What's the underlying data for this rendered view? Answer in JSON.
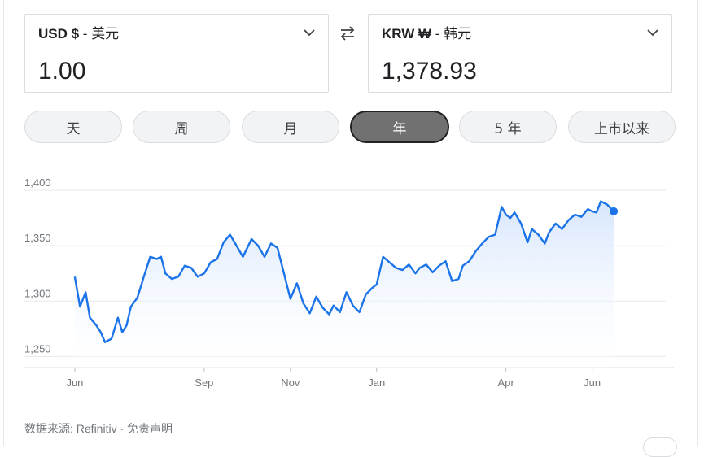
{
  "from_currency": {
    "code": "USD $",
    "name": "美元",
    "separator": " - ",
    "value": "1.00"
  },
  "to_currency": {
    "code": "KRW ₩",
    "name": "韩元",
    "separator": " - ",
    "value": "1,378.93"
  },
  "swap_icon": "swap-arrows-icon",
  "range_tabs": [
    {
      "label": "天",
      "active": false
    },
    {
      "label": "周",
      "active": false
    },
    {
      "label": "月",
      "active": false
    },
    {
      "label": "年",
      "active": true
    },
    {
      "label": "5 年",
      "active": false
    },
    {
      "label": "上市以来",
      "active": false
    }
  ],
  "footer": {
    "text": "数据来源: Refinitiv · 免责声明"
  },
  "colors": {
    "line": "#1a73e8",
    "fill_top": "#d2e3fc",
    "active_tab": "#717171",
    "grid": "#e8eaed"
  },
  "chart_data": {
    "type": "area",
    "ylim": [
      1240,
      1400
    ],
    "yticks": [
      1250,
      1300,
      1350,
      1400
    ],
    "ytick_labels": [
      "1,250",
      "1,300",
      "1,350",
      "1,400"
    ],
    "xtick_labels": [
      "Jun",
      "Sep",
      "Nov",
      "Jan",
      "Apr",
      "Jun"
    ],
    "xtick_positions": [
      0,
      3,
      5,
      7,
      10,
      12
    ],
    "xlim": [
      -0.15,
      12.8
    ],
    "grid": true,
    "x": [
      0,
      0.12,
      0.25,
      0.35,
      0.5,
      0.6,
      0.7,
      0.85,
      1.0,
      1.1,
      1.2,
      1.3,
      1.45,
      1.6,
      1.75,
      1.9,
      2.0,
      2.1,
      2.25,
      2.4,
      2.55,
      2.7,
      2.85,
      3.0,
      3.15,
      3.3,
      3.45,
      3.6,
      3.75,
      3.9,
      4.0,
      4.1,
      4.25,
      4.4,
      4.55,
      4.7,
      4.85,
      5.0,
      5.15,
      5.3,
      5.45,
      5.6,
      5.75,
      5.9,
      6.0,
      6.15,
      6.3,
      6.45,
      6.6,
      6.75,
      6.9,
      7.0,
      7.15,
      7.3,
      7.45,
      7.6,
      7.75,
      7.9,
      8.0,
      8.15,
      8.3,
      8.45,
      8.6,
      8.75,
      8.9,
      9.0,
      9.15,
      9.3,
      9.45,
      9.6,
      9.75,
      9.9,
      10.0,
      10.1,
      10.2,
      10.35,
      10.5,
      10.6,
      10.75,
      10.9,
      11.0,
      11.15,
      11.3,
      11.45,
      11.6,
      11.75,
      11.9,
      12.0,
      12.1,
      12.2,
      12.35,
      12.5
    ],
    "values": [
      1322,
      1295,
      1308,
      1285,
      1278,
      1272,
      1263,
      1266,
      1285,
      1272,
      1278,
      1295,
      1303,
      1322,
      1340,
      1338,
      1340,
      1325,
      1320,
      1322,
      1332,
      1330,
      1322,
      1325,
      1335,
      1338,
      1353,
      1360,
      1350,
      1340,
      1348,
      1356,
      1350,
      1340,
      1352,
      1348,
      1325,
      1302,
      1316,
      1298,
      1289,
      1304,
      1294,
      1288,
      1296,
      1290,
      1308,
      1296,
      1290,
      1306,
      1312,
      1315,
      1340,
      1335,
      1330,
      1328,
      1333,
      1325,
      1330,
      1333,
      1326,
      1332,
      1336,
      1318,
      1320,
      1332,
      1336,
      1345,
      1352,
      1358,
      1360,
      1385,
      1378,
      1375,
      1380,
      1370,
      1353,
      1365,
      1360,
      1352,
      1362,
      1370,
      1365,
      1373,
      1378,
      1376,
      1383,
      1381,
      1380,
      1390,
      1387,
      1381
    ],
    "last_point": {
      "x": 12.5,
      "y": 1381
    }
  }
}
